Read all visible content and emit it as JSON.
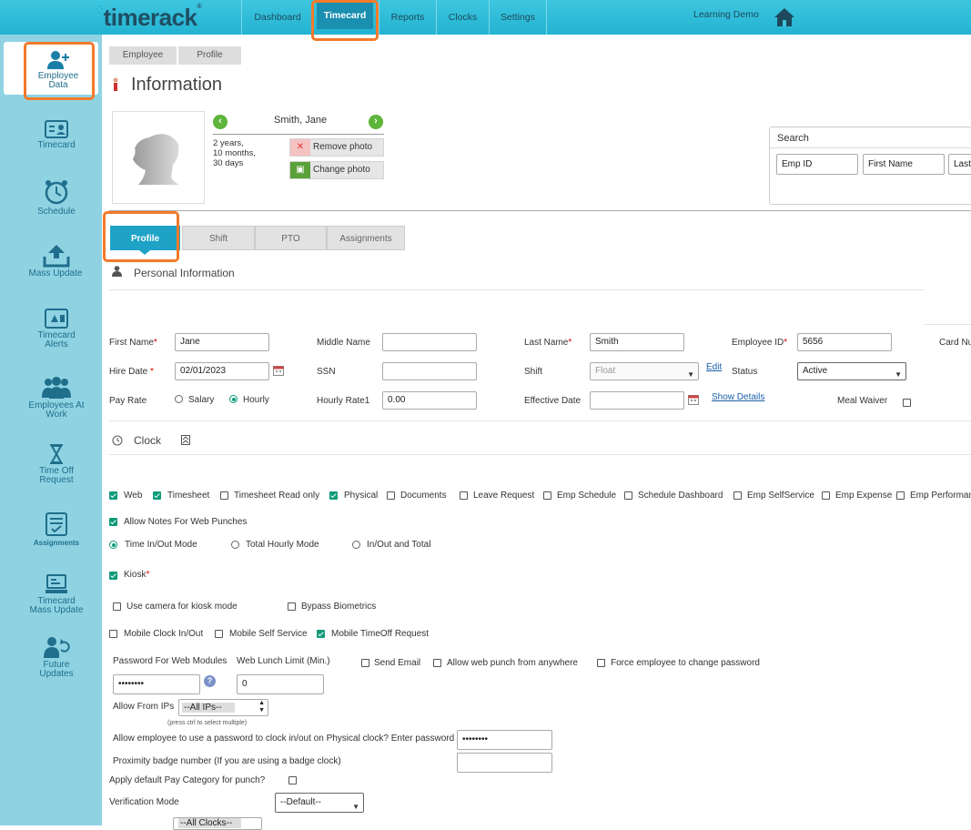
{
  "header": {
    "logo": "timerack",
    "nav": [
      "Dashboard",
      "Timecard",
      "Reports",
      "Clocks",
      "Settings"
    ],
    "account": "Learning Demo"
  },
  "sidebar": {
    "items": [
      {
        "label": "Employee Data",
        "icon": "add-user-icon"
      },
      {
        "label": "Timecard",
        "icon": "timecard-icon"
      },
      {
        "label": "Schedule",
        "icon": "alarm-clock-icon"
      },
      {
        "label": "Mass Update",
        "icon": "upload-icon"
      },
      {
        "label": "Timecard Alerts",
        "icon": "alert-card-icon"
      },
      {
        "label": "Employees At Work",
        "icon": "group-icon"
      },
      {
        "label": "Time Off Request",
        "icon": "hourglass-icon"
      },
      {
        "label": "Assignments",
        "icon": "checklist-icon"
      },
      {
        "label": "Timecard Mass Update",
        "icon": "computer-icon"
      },
      {
        "label": "Future Updates",
        "icon": "user-refresh-icon"
      }
    ]
  },
  "breadcrumb": [
    "Employee",
    "Profile"
  ],
  "page_title": "Information",
  "employee": {
    "name": "Smith, Jane",
    "tenure": [
      "2 years,",
      "10 months,",
      "30 days"
    ],
    "remove_photo": "Remove photo",
    "change_photo": "Change photo"
  },
  "search": {
    "title": "Search",
    "fields": [
      "Emp ID",
      "First Name",
      "Last"
    ]
  },
  "tabs": [
    "Profile",
    "Shift",
    "PTO",
    "Assignments"
  ],
  "personal": {
    "section_title": "Personal Information",
    "first_name_label": "First Name",
    "first_name": "Jane",
    "middle_name_label": "Middle Name",
    "middle_name": "",
    "last_name_label": "Last Name",
    "last_name": "Smith",
    "employee_id_label": "Employee ID",
    "employee_id": "5656",
    "card_label": "Card Nu",
    "hire_date_label": "Hire Date",
    "hire_date": "02/01/2023",
    "ssn_label": "SSN",
    "shift_label": "Shift",
    "shift_value": "Float",
    "edit_link": "Edit",
    "status_label": "Status",
    "status_value": "Active",
    "pay_rate_label": "Pay Rate",
    "salary_label": "Salary",
    "hourly_label": "Hourly",
    "hourly_rate_label": "Hourly Rate1",
    "hourly_rate": "0.00",
    "effective_date_label": "Effective Date",
    "show_details": "Show Details",
    "meal_waiver_label": "Meal Waiver"
  },
  "clock": {
    "section_title": "Clock",
    "modules": [
      {
        "label": "Web",
        "checked": true
      },
      {
        "label": "Timesheet",
        "checked": true
      },
      {
        "label": "Timesheet Read only",
        "checked": false
      },
      {
        "label": "Physical",
        "checked": true
      },
      {
        "label": "Documents",
        "checked": false
      },
      {
        "label": "Leave Request",
        "checked": false
      },
      {
        "label": "Emp Schedule",
        "checked": false
      },
      {
        "label": "Schedule Dashboard",
        "checked": false
      },
      {
        "label": "Emp SelfService",
        "checked": false
      },
      {
        "label": "Emp Expense",
        "checked": false
      },
      {
        "label": "Emp Performan",
        "checked": false
      }
    ],
    "allow_notes": "Allow Notes For Web Punches",
    "modes": [
      "Time In/Out Mode",
      "Total Hourly Mode",
      "In/Out and Total"
    ],
    "kiosk": "Kiosk",
    "use_camera": "Use camera for kiosk mode",
    "bypass_biometrics": "Bypass Biometrics",
    "mobile_clock": "Mobile Clock In/Out",
    "mobile_self_service": "Mobile Self Service",
    "mobile_timeoff": "Mobile TimeOff Request",
    "password_label": "Password For Web Modules",
    "password_value": "••••••••",
    "lunch_limit_label": "Web Lunch Limit (Min.)",
    "lunch_limit_value": "0",
    "send_email": "Send Email",
    "allow_anywhere": "Allow web punch from anywhere",
    "force_change": "Force employee to change password",
    "allow_ips_label": "Allow From IPs",
    "allow_ips_value": "--All IPs--",
    "ctrl_hint": "(press ctrl to select multiple)",
    "physical_pw_label": "Allow employee to use a password to clock in/out on Physical clock? Enter password",
    "physical_pw_value": "••••••••",
    "proximity_label": "Proximity badge number (If you are using a badge clock)",
    "default_pay_label": "Apply default Pay Category for punch?",
    "verification_label": "Verification Mode",
    "verification_value": "--Default--",
    "clocks_value": "--All Clocks--"
  },
  "colors": {
    "topbar": "#22b3d2",
    "sidebar": "#8fd3e3",
    "highlight": "#f47a2a",
    "check": "#0f9a7a"
  }
}
